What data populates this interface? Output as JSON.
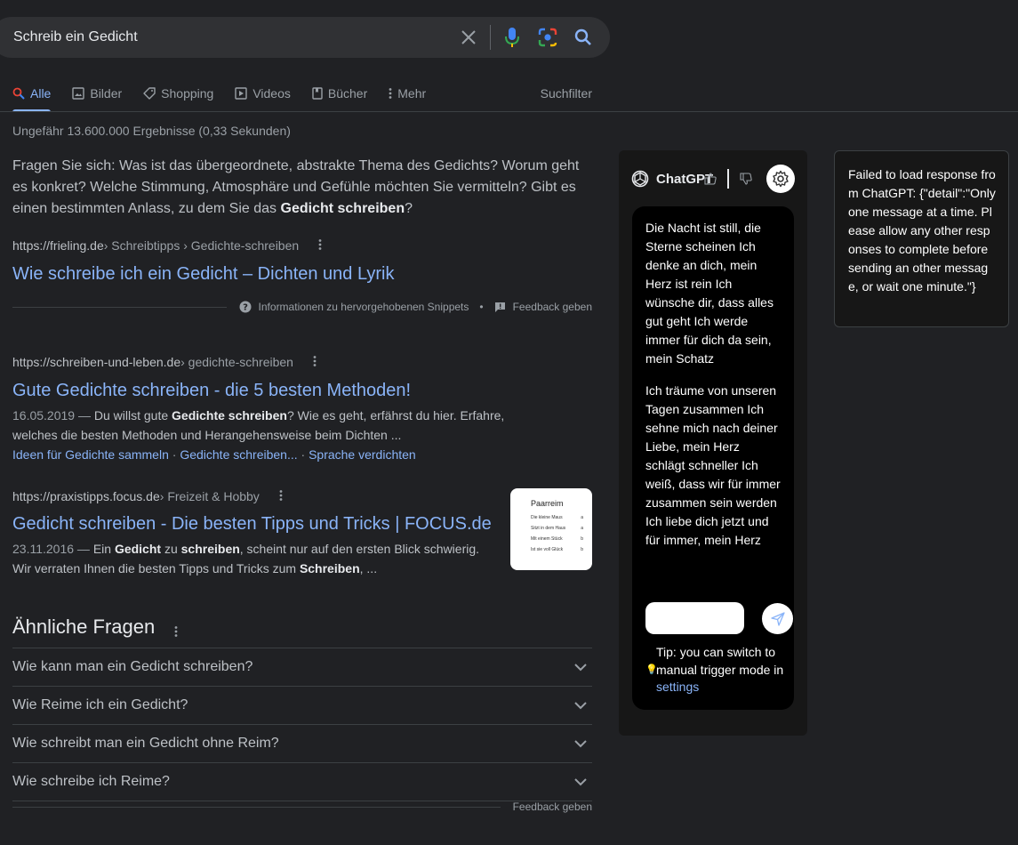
{
  "search": {
    "query": "Schreib ein Gedicht"
  },
  "tabs": [
    {
      "label": "Alle"
    },
    {
      "label": "Bilder"
    },
    {
      "label": "Shopping"
    },
    {
      "label": "Videos"
    },
    {
      "label": "Bücher"
    },
    {
      "label": "Mehr"
    }
  ],
  "filter_label": "Suchfilter",
  "stats": "Ungefähr 13.600.000 Ergebnisse (0,33 Sekunden)",
  "featured": {
    "text_before": "Fragen Sie sich: Was ist das übergeordnete, abstrakte Thema des Gedichts? Worum geht es konkret? Welche Stimmung, Atmosphäre und Gefühle möchten Sie vermitteln? Gibt es einen bestimmten Anlass, zu dem Sie das ",
    "text_bold": "Gedicht schreiben",
    "text_after": "?",
    "domain": "https://frieling.de",
    "crumb": " › Schreibtipps › Gedichte-schreiben",
    "title": "Wie schreibe ich ein Gedicht – Dichten und Lyrik",
    "info_label": "Informationen zu hervorgehobenen Snippets",
    "bullet": "•",
    "feedback_label": "Feedback geben"
  },
  "results": [
    {
      "domain": "https://schreiben-und-leben.de",
      "crumb": " › gedichte-schreiben",
      "title": "Gute Gedichte schreiben - die 5 besten Methoden!",
      "date": "16.05.2019 — ",
      "d1": "Du willst gute ",
      "b1": "Gedichte schreiben",
      "d2": "? Wie es geht, erfährst du hier. Erfahre, welches die besten Methoden und Herangehensweise beim Dichten ...",
      "sitelinks": [
        "Ideen für Gedichte sammeln",
        "Gedichte schreiben...",
        "Sprache verdichten"
      ],
      "sitelink_sep": " · "
    },
    {
      "domain": "https://praxistipps.focus.de",
      "crumb": " › Freizeit & Hobby",
      "title": "Gedicht schreiben - Die besten Tipps und Tricks | FOCUS.de",
      "date": "23.11.2016 — ",
      "d1": "Ein ",
      "b1": "Gedicht",
      "d2": " zu ",
      "b2": "schreiben",
      "d3": ", scheint nur auf den ersten Blick schwierig. Wir verraten Ihnen die besten Tipps und Tricks zum ",
      "b3": "Schreiben",
      "d4": ", ...",
      "thumb": {
        "title": "Paarreim",
        "rows": [
          {
            "text": "Die kleine Maus",
            "rhyme": "a"
          },
          {
            "text": "Sitzt in dem Haus",
            "rhyme": "a"
          },
          {
            "text": "Mit einem Stück",
            "rhyme": "b"
          },
          {
            "text": "Ist sie voll Glück",
            "rhyme": "b"
          }
        ]
      }
    }
  ],
  "paa": {
    "heading": "Ähnliche Fragen",
    "questions": [
      "Wie kann man ein Gedicht schreiben?",
      "Wie Reime ich ein Gedicht?",
      "Wie schreibt man ein Gedicht ohne Reim?",
      "Wie schreibe ich Reime?"
    ],
    "feedback_label": "Feedback geben"
  },
  "chatgpt": {
    "name": "ChatGPT",
    "para1": "Die Nacht ist still, die Sterne scheinen Ich denke an dich, mein Herz ist rein Ich wünsche dir, dass alles gut geht Ich werde immer für dich da sein, mein Schatz",
    "para2": "Ich träume von unseren Tagen zusammen Ich sehne mich nach deiner Liebe, mein Herz schlägt schneller Ich weiß, dass wir für immer zusammen sein werden Ich liebe dich jetzt und für immer, mein Herz",
    "input_value": "",
    "tip_text": "Tip: you can switch to manual trigger mode in ",
    "tip_link": "settings"
  },
  "error_panel": {
    "message": "Failed to load response from ChatGPT: {\"detail\":\"Only one message at a time. Please allow any other responses to complete before sending an other message, or wait one minute.\"}"
  },
  "colors": {
    "background": "#202124",
    "link": "#8ab4f8",
    "text": "#bdc1c6",
    "muted": "#9aa0a6",
    "panel": "#171717"
  }
}
